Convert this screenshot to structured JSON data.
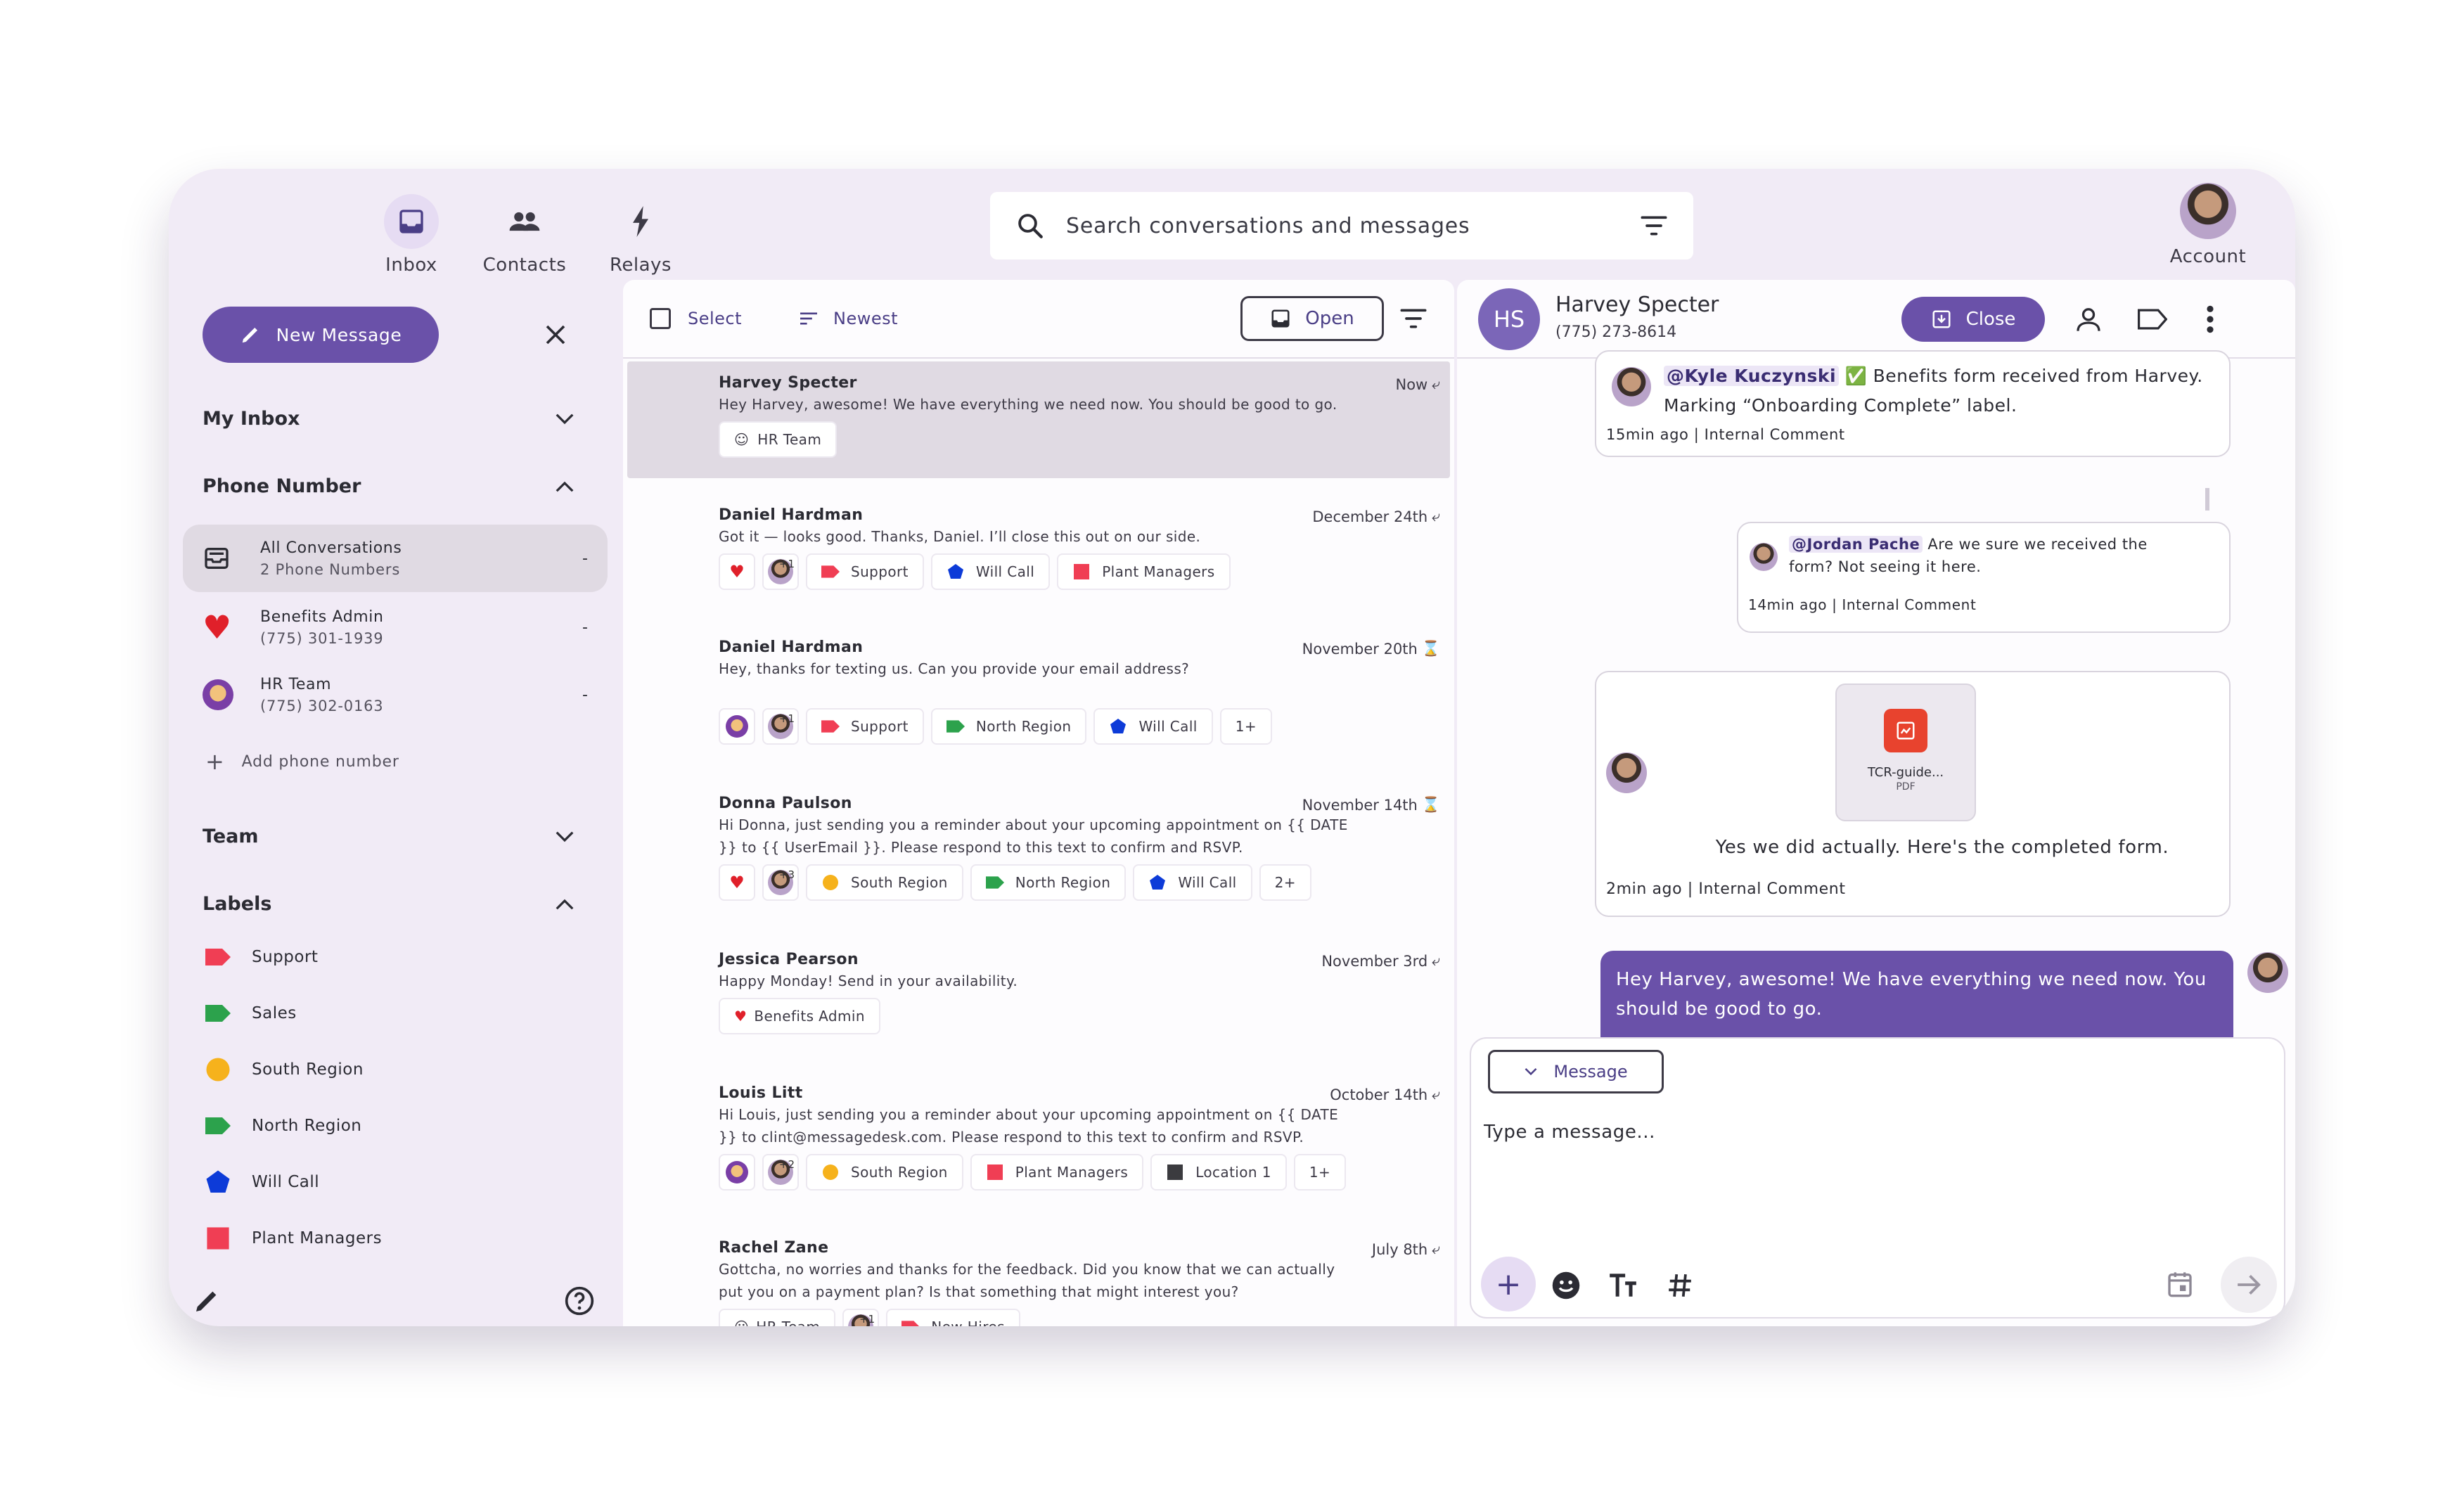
{
  "nav": {
    "inbox": "Inbox",
    "contacts": "Contacts",
    "relays": "Relays",
    "account": "Account"
  },
  "search": {
    "placeholder": "Search conversations and messages"
  },
  "sidebar": {
    "new_message": "New Message",
    "my_inbox": "My Inbox",
    "phone_number": "Phone Number",
    "phone_items": [
      {
        "title": "All Conversations",
        "sub": "2 Phone Numbers",
        "count": "-"
      },
      {
        "title": "Benefits Admin",
        "sub": "(775) 301-1939",
        "count": "-",
        "emoji": "❤️"
      },
      {
        "title": "HR Team",
        "sub": "(775) 302-0163",
        "count": "-",
        "emoji": "🙋‍♀️"
      }
    ],
    "add_phone": "Add phone number",
    "team": "Team",
    "labels_title": "Labels",
    "labels": [
      {
        "name": "Support",
        "color": "#f03e54",
        "shape": "tag"
      },
      {
        "name": "Sales",
        "color": "#2ca24c",
        "shape": "tag"
      },
      {
        "name": "South Region",
        "color": "#f6b21c",
        "shape": "circle"
      },
      {
        "name": "North Region",
        "color": "#2ca24c",
        "shape": "tag"
      },
      {
        "name": "Will Call",
        "color": "#0d3bd8",
        "shape": "pentagon"
      },
      {
        "name": "Plant Managers",
        "color": "#f03e54",
        "shape": "square"
      }
    ]
  },
  "list": {
    "select": "Select",
    "sort": "Newest",
    "status": "Open",
    "conversations": [
      {
        "name": "Harvey Specter",
        "time": "Now",
        "msg": "Hey Harvey, awesome! We have everything we need now. You should be good to go.",
        "chips": [
          {
            "text": "HR Team",
            "emoji": "🙋‍♀️"
          }
        ]
      },
      {
        "name": "Daniel Hardman",
        "time": "December 24th",
        "msg": "Got it — looks good. Thanks, Daniel. I’ll close this out on our side.",
        "avatar_count": "+1",
        "chips": [
          {
            "text": "Support",
            "color": "#f03e54",
            "shape": "tag"
          },
          {
            "text": "Will Call",
            "color": "#0d3bd8",
            "shape": "pentagon"
          },
          {
            "text": "Plant Managers",
            "color": "#f03e54",
            "shape": "square"
          }
        ]
      },
      {
        "name": "Daniel Hardman",
        "time": "November 20th",
        "msg": "Hey, thanks for texting us. Can you provide your email address?",
        "avatar_count": "+1",
        "chips": [
          {
            "text": "Support",
            "color": "#f03e54",
            "shape": "tag"
          },
          {
            "text": "North Region",
            "color": "#2ca24c",
            "shape": "tag"
          },
          {
            "text": "Will Call",
            "color": "#0d3bd8",
            "shape": "pentagon"
          },
          {
            "text": "1+"
          }
        ]
      },
      {
        "name": "Donna Paulson",
        "time": "November 14th",
        "msg": "Hi Donna, just sending you a reminder about your upcoming appointment on {{ DATE }} to {{ UserEmail }}. Please respond to this text to confirm and RSVP.",
        "avatar_count": "+3",
        "chips": [
          {
            "text": "South Region",
            "color": "#f6b21c",
            "shape": "circle"
          },
          {
            "text": "North Region",
            "color": "#2ca24c",
            "shape": "tag"
          },
          {
            "text": "Will Call",
            "color": "#0d3bd8",
            "shape": "pentagon"
          },
          {
            "text": "2+"
          }
        ]
      },
      {
        "name": "Jessica Pearson",
        "time": "November 3rd",
        "msg": "Happy Monday! Send in your availability.",
        "chips": [
          {
            "text": "Benefits Admin",
            "emoji": "❤️"
          }
        ]
      },
      {
        "name": "Louis Litt",
        "time": "October 14th",
        "msg": "Hi Louis, just sending you a reminder about your upcoming appointment on {{ DATE }} to clint@messagedesk.com. Please respond to this text to confirm and RSVP.",
        "avatar_count": "+2",
        "chips": [
          {
            "text": "South Region",
            "color": "#f6b21c",
            "shape": "circle"
          },
          {
            "text": "Plant Managers",
            "color": "#f03e54",
            "shape": "square"
          },
          {
            "text": "Location 1",
            "color": "#3b3b3f",
            "shape": "square"
          },
          {
            "text": "1+"
          }
        ]
      },
      {
        "name": "Rachel Zane",
        "time": "July 8th",
        "msg": "Gottcha, no worries and thanks for the feedback. Did you know that we can actually put you on a payment plan? Is that something that might interest you?",
        "avatar_count": "+1",
        "chips": [
          {
            "text": "HR Team",
            "emoji": "🙋‍♀️"
          },
          {
            "text": "New Hires",
            "color": "#f03e54",
            "shape": "tag"
          }
        ]
      }
    ]
  },
  "chat": {
    "initials": "HS",
    "name": "Harvey Specter",
    "phone": "(775) 273-8614",
    "close": "Close",
    "note1": {
      "mention": "@Kyle Kuczynski",
      "check": "✅",
      "text": " Benefits form received from Harvey. Marking “Onboarding Complete” label.",
      "meta": "15min ago | Internal Comment"
    },
    "note2": {
      "mention": "@Jordan Pache",
      "text": " Are we sure we received the form? Not seeing it here.",
      "meta": "14min ago | Internal Comment"
    },
    "note3": {
      "file": "TCR-guide...",
      "filetype": "PDF",
      "text": "Yes we did actually. Here's the completed form.",
      "meta": "2min ago | Internal Comment"
    },
    "outgoing": "Hey Harvey, awesome! We have everything we need now. You should be good to go.",
    "composer_mode": "Message",
    "composer_placeholder": "Type a message..."
  },
  "colors": {
    "accent": "#6a51a9",
    "frame": "#f1ebf6",
    "selected": "#e0dae3"
  }
}
